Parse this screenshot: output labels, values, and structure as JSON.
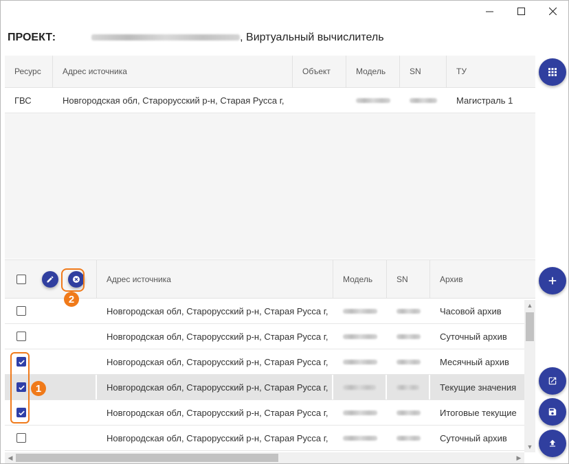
{
  "window": {
    "controls": [
      "minimize",
      "maximize",
      "close"
    ]
  },
  "project": {
    "label": "ПРОЕКТ:",
    "name_suffix": ", Виртуальный вычислитель"
  },
  "top_grid": {
    "columns": [
      "Ресурс",
      "Адрес источника",
      "Объект",
      "Модель",
      "SN",
      "ТУ"
    ],
    "rows": [
      {
        "resource": "ГВС",
        "address": "Новгородская обл, Старорусский р-н, Старая Русса г,",
        "object": "",
        "tu": "Магистраль 1"
      }
    ]
  },
  "bottom_grid": {
    "columns": [
      "Адрес источника",
      "Модель",
      "SN",
      "Архив"
    ],
    "rows": [
      {
        "checked": false,
        "selected": false,
        "address": "Новгородская обл, Старорусский р-н, Старая Русса г,",
        "archive": "Часовой архив"
      },
      {
        "checked": false,
        "selected": false,
        "address": "Новгородская обл, Старорусский р-н, Старая Русса г,",
        "archive": "Суточный архив"
      },
      {
        "checked": true,
        "selected": false,
        "address": "Новгородская обл, Старорусский р-н, Старая Русса г,",
        "archive": "Месячный архив"
      },
      {
        "checked": true,
        "selected": true,
        "address": "Новгородская обл, Старорусский р-н, Старая Русса г,",
        "archive": "Текущие значения"
      },
      {
        "checked": true,
        "selected": false,
        "address": "Новгородская обл, Старорусский р-н, Старая Русса г,",
        "archive": "Итоговые текущие"
      },
      {
        "checked": false,
        "selected": false,
        "address": "Новгородская обл, Старорусский р-н, Старая Русса г,",
        "archive": "Суточный архив"
      }
    ]
  },
  "annotations": {
    "callout_1": "1",
    "callout_2": "2"
  },
  "icons": {
    "grid_button": "apps-grid-icon",
    "edit": "pencil-icon",
    "delete": "close-circle-icon",
    "add": "plus-icon",
    "open_external": "open-in-new-icon",
    "save": "floppy-disk-icon",
    "upload": "upload-icon"
  },
  "colors": {
    "accent": "#303f9f",
    "checkbox_checked": "#2f3fa8",
    "callout": "#f07a1a",
    "selected_row": "#e4e4e4",
    "header_bg": "#f5f5f5"
  }
}
